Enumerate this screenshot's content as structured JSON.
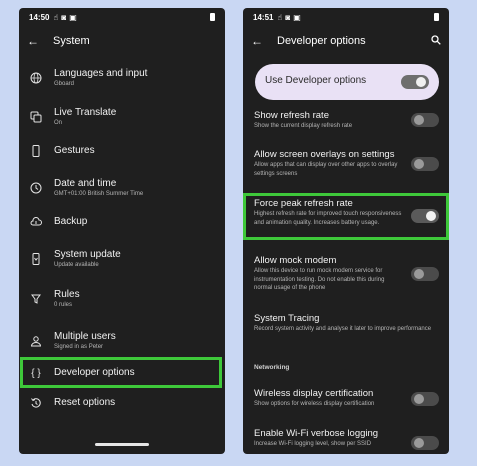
{
  "left": {
    "status": {
      "time": "14:50"
    },
    "appbar": {
      "title": "System"
    },
    "items": [
      {
        "icon": "globe-icon",
        "title": "Languages and input",
        "subtitle": "Gboard"
      },
      {
        "icon": "translate-icon",
        "title": "Live Translate",
        "subtitle": "On"
      },
      {
        "icon": "phone-icon",
        "title": "Gestures",
        "subtitle": ""
      },
      {
        "icon": "clock-icon",
        "title": "Date and time",
        "subtitle": "GMT+01:00 British Summer Time"
      },
      {
        "icon": "backup-icon",
        "title": "Backup",
        "subtitle": ""
      },
      {
        "icon": "system-update-icon",
        "title": "System update",
        "subtitle": "Update available"
      },
      {
        "icon": "rules-icon",
        "title": "Rules",
        "subtitle": "0 rules"
      },
      {
        "icon": "user-icon",
        "title": "Multiple users",
        "subtitle": "Signed in as Peter"
      },
      {
        "icon": "braces-icon",
        "title": "Developer options",
        "subtitle": ""
      },
      {
        "icon": "reset-icon",
        "title": "Reset options",
        "subtitle": ""
      }
    ]
  },
  "right": {
    "status": {
      "time": "14:51"
    },
    "appbar": {
      "title": "Developer options"
    },
    "master": {
      "label": "Use Developer options",
      "on": true
    },
    "items": [
      {
        "title": "Show refresh rate",
        "subtitle": "Show the current display refresh rate",
        "on": false
      },
      {
        "title": "Allow screen overlays on settings",
        "subtitle": "Allow apps that can display over other apps to overlay settings screens",
        "on": false
      },
      {
        "title": "Force peak refresh rate",
        "subtitle": "Highest refresh rate for improved touch responsiveness and animation quality. Increases battery usage.",
        "on": true
      },
      {
        "title": "Allow mock modem",
        "subtitle": "Allow this device to run mock modem service for instrumentation testing. Do not enable this during normal usage of the phone",
        "on": false
      },
      {
        "title": "System Tracing",
        "subtitle": "Record system activity and analyse it later to improve performance"
      }
    ],
    "section": "Networking",
    "items2": [
      {
        "title": "Wireless display certification",
        "subtitle": "Show options for wireless display certification",
        "on": false
      },
      {
        "title": "Enable Wi-Fi verbose logging",
        "subtitle": "Increase Wi-Fi logging level, show per SSID",
        "on": false
      }
    ]
  },
  "colors": {
    "highlight": "#3ec83a",
    "screen": "#1f1f1f",
    "backdrop": "#c9d7f3",
    "card": "#e9e1f5"
  }
}
